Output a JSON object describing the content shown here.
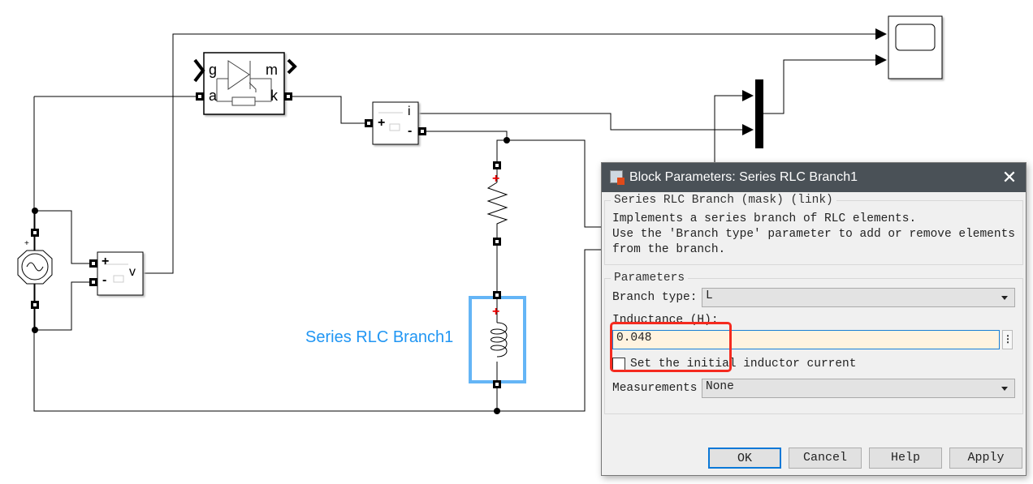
{
  "diagram": {
    "thyristor": {
      "port_g": "g",
      "port_a": "a",
      "port_m": "m",
      "port_k": "k"
    },
    "current_meas": {
      "out": "i",
      "plus": "+",
      "minus": "-"
    },
    "voltage_meas": {
      "out": "v",
      "plus": "+",
      "minus": "-"
    },
    "selected_block_label": "Series RLC Branch1",
    "selection_color": "#64b5f6",
    "wire_color": "#000000"
  },
  "dialog": {
    "title": "Block Parameters: Series RLC Branch1",
    "mask_legend": "Series RLC Branch (mask) (link)",
    "description": [
      "Implements a series branch of RLC elements.",
      "Use the 'Branch type' parameter to add or remove elements",
      "from the branch."
    ],
    "params_legend": "Parameters",
    "branch_type_label": "Branch type:",
    "branch_type_value": "L",
    "inductance_label": "Inductance (H):",
    "inductance_value": "0.048",
    "initial_current_label": "Set the initial inductor current",
    "initial_current_checked": false,
    "measurements_label": "Measurements",
    "measurements_value": "None",
    "buttons": {
      "ok": "OK",
      "cancel": "Cancel",
      "help": "Help",
      "apply": "Apply"
    },
    "highlight_color": "#f52a1f"
  }
}
